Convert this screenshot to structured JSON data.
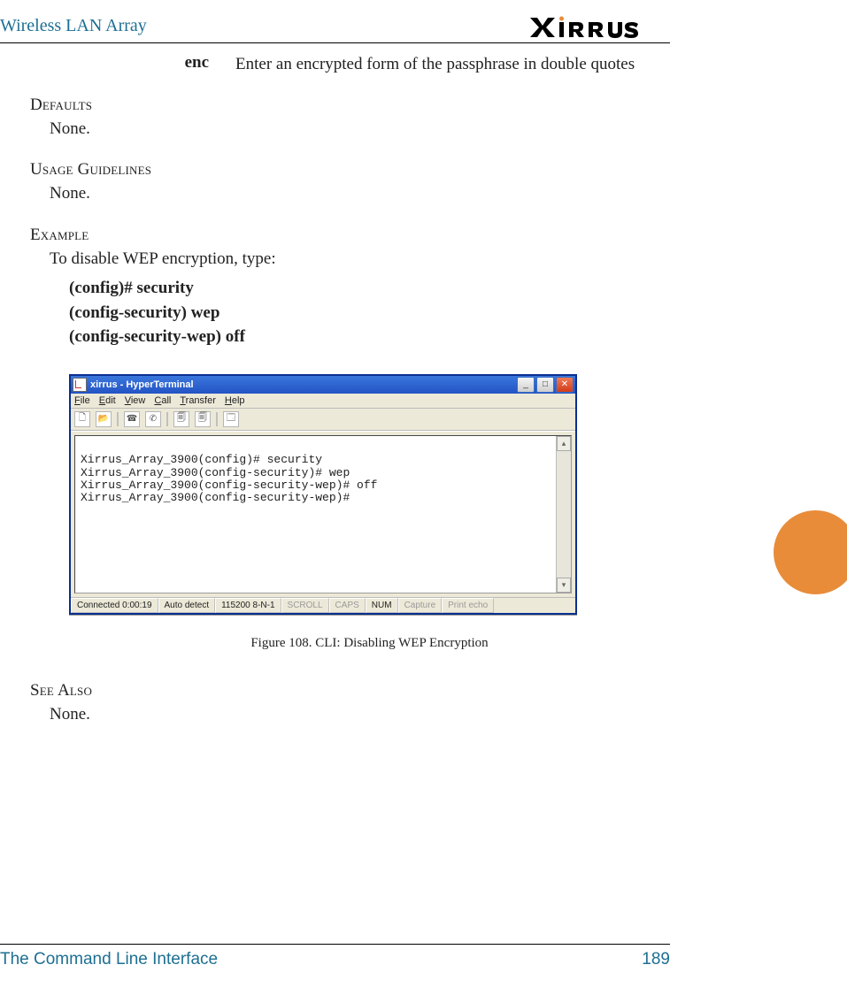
{
  "header": {
    "title": "Wireless LAN Array",
    "brand": "XIRRUS"
  },
  "brand_dot": "•",
  "param": {
    "term": "enc",
    "desc": "Enter an encrypted form of the passphrase in double quotes"
  },
  "sections": {
    "defaults": {
      "head": "Defaults",
      "body": "None."
    },
    "usage": {
      "head": "Usage Guidelines",
      "body": "None."
    },
    "example": {
      "head": "Example",
      "body": "To disable WEP encryption, type:"
    },
    "seealso": {
      "head": "See Also",
      "body": "None."
    }
  },
  "example_cmds": {
    "l1": "(config)# security",
    "l2": "(config-security) wep",
    "l3": "(config-security-wep) off"
  },
  "hyperterm": {
    "title": "xirrus - HyperTerminal",
    "menu": {
      "file": "File",
      "edit": "Edit",
      "view": "View",
      "call": "Call",
      "transfer": "Transfer",
      "help": "Help"
    },
    "terminal_lines": "\nXirrus_Array_3900(config)# security\nXirrus_Array_3900(config-security)# wep\nXirrus_Array_3900(config-security-wep)# off\nXirrus_Array_3900(config-security-wep)#",
    "status": {
      "connected": "Connected 0:00:19",
      "detect": "Auto detect",
      "baud": "115200 8-N-1",
      "scroll": "SCROLL",
      "caps": "CAPS",
      "num": "NUM",
      "capture": "Capture",
      "echo": "Print echo"
    }
  },
  "figure_caption": "Figure 108. CLI: Disabling WEP Encryption",
  "footer": {
    "chapter": "The Command Line Interface",
    "page": "189"
  }
}
